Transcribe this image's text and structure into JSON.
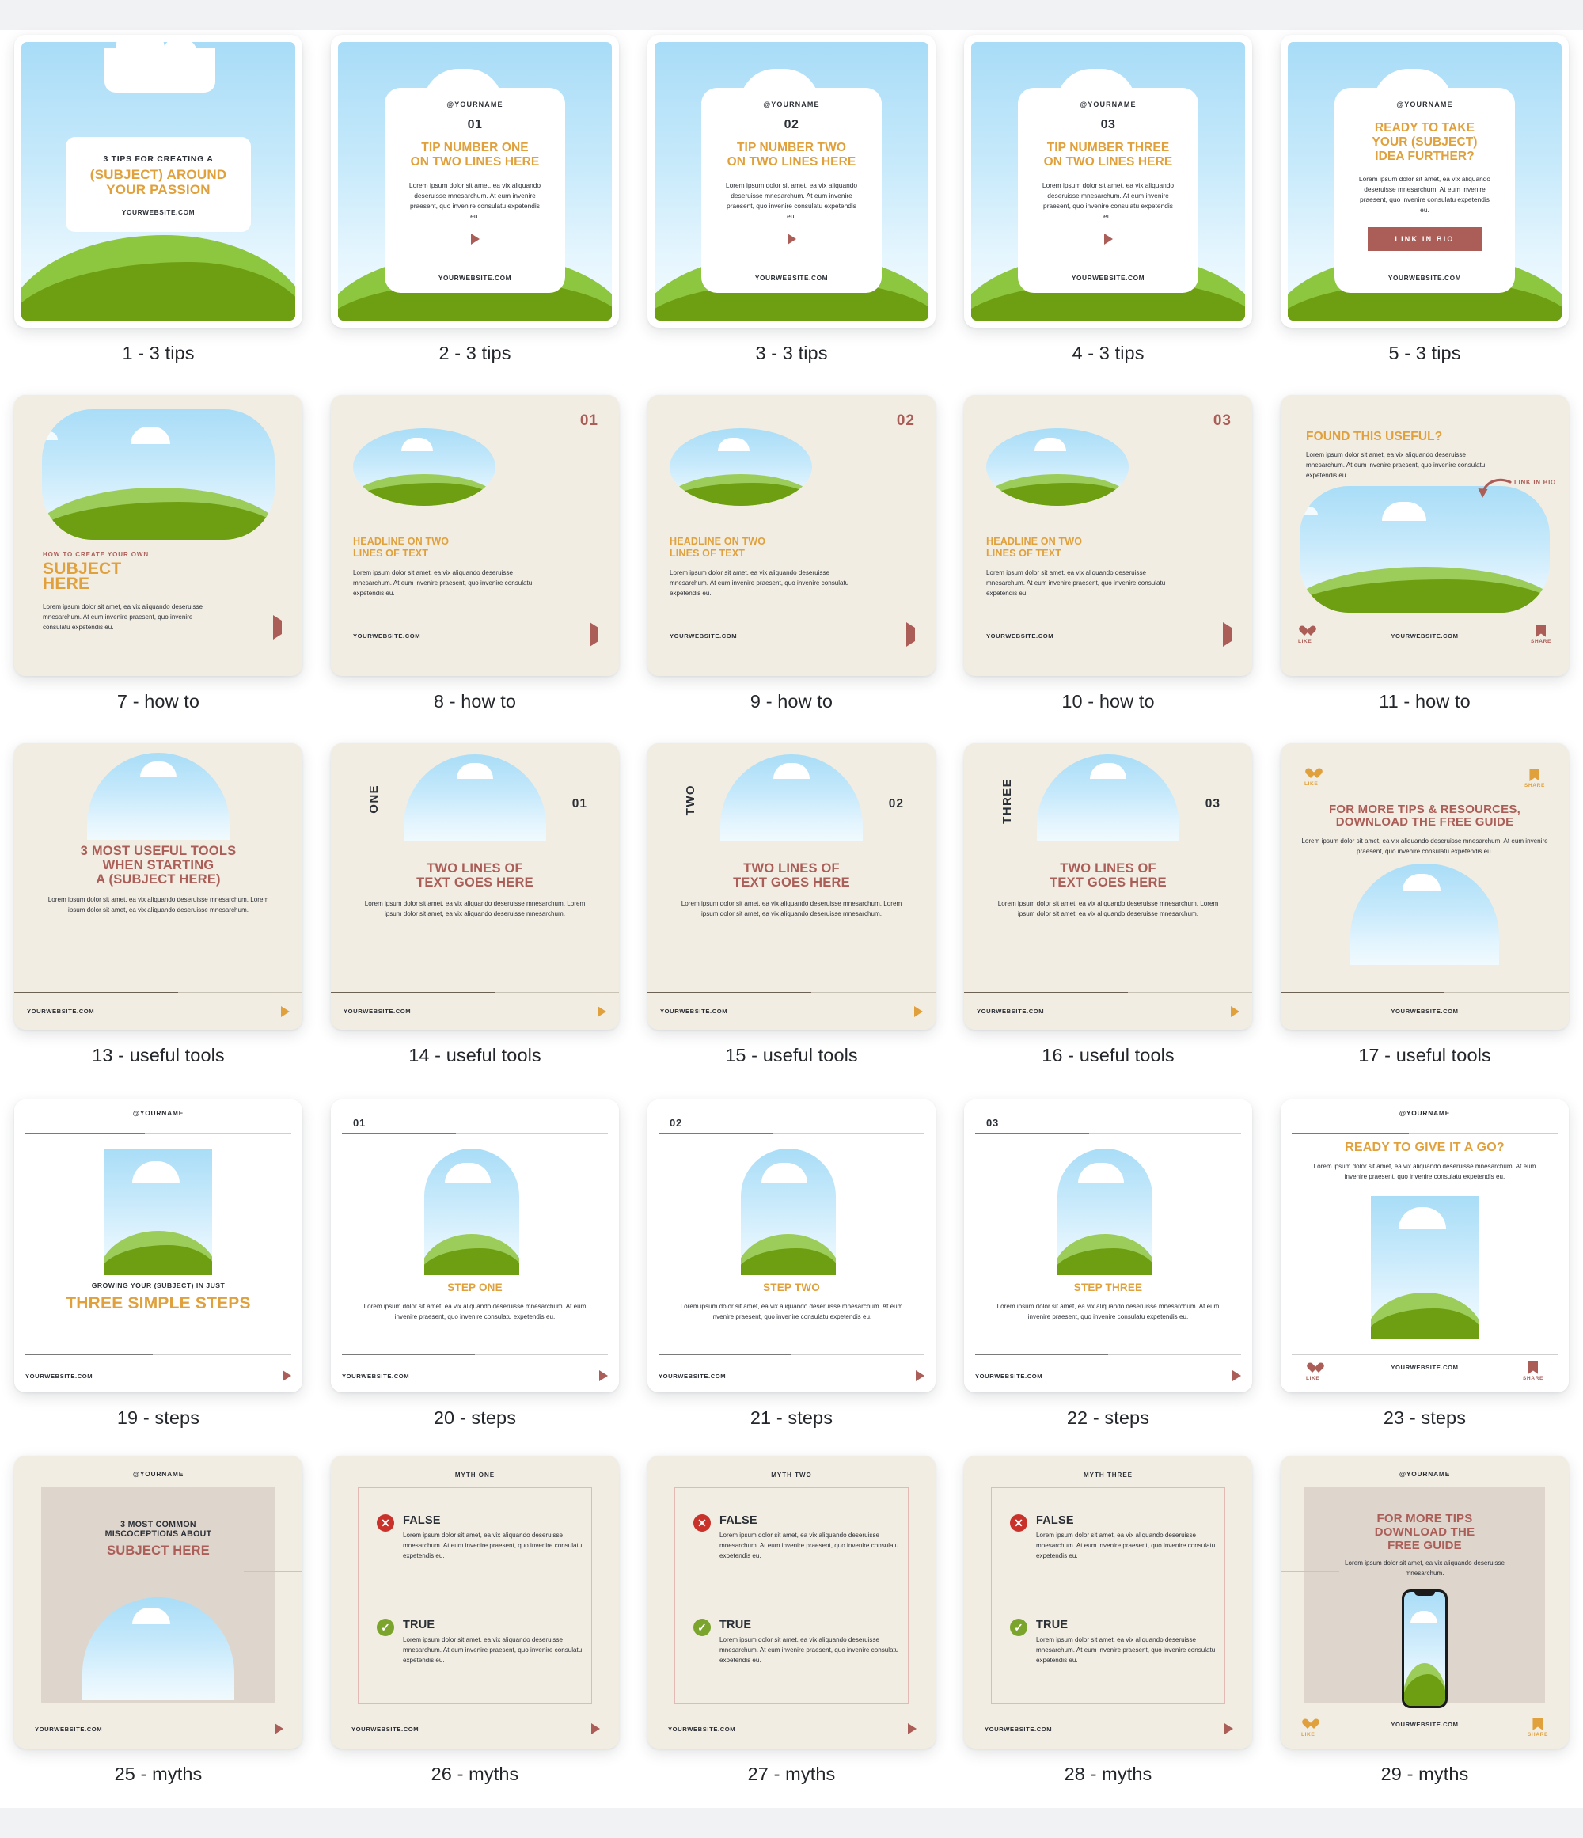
{
  "brand": {
    "orange": "#e0a13c",
    "rose": "#ab5e57",
    "green_light": "#9ccc5a",
    "green_dark": "#6e9e12",
    "sky": "#a9ddf7",
    "beige": "#f2ede3",
    "tan": "#ded5cd",
    "red": "#c8322a",
    "check_green": "#7aa42b"
  },
  "common": {
    "handle": "@YOURNAME",
    "website": "YOURWEBSITE.COM",
    "lorem_4line": "Lorem ipsum dolor sit amet, ea vix aliquando deseruisse mnesarchum. At eum invenire praesent, quo invenire consulatu expetendis eu.",
    "lorem_3line": "Lorem ipsum dolor sit amet, ea vix aliquando deseruisse mnesarchum. At eum invenire praesent, quo invenire consulatu expetendis eu.",
    "lorem_long": "Lorem ipsum dolor sit amet, ea vix aliquando deseruisse mnesarchum. Lorem ipsum dolor sit amet, ea vix aliquando deseruisse mnesarchum.",
    "lorem_short": "Lorem ipsum dolor sit amet, ea vix aliquando deseruisse mnesarchum.",
    "like": "LIKE",
    "share": "SHARE",
    "link_in_bio": "LINK IN BIO"
  },
  "cards": [
    {
      "caption": "1 - 3 tips",
      "eyebrow": "3 TIPS FOR CREATING A",
      "title": "(SUBJECT) AROUND YOUR PASSION",
      "website": "YOURWEBSITE.COM"
    },
    {
      "caption": "2 - 3 tips",
      "handle": "@YOURNAME",
      "number": "01",
      "title_l1": "TIP NUMBER ONE",
      "title_l2": "ON TWO LINES HERE",
      "body": "Lorem ipsum dolor sit amet, ea vix aliquando deseruisse mnesarchum. At eum invenire praesent, quo invenire consulatu expetendis eu.",
      "website": "YOURWEBSITE.COM"
    },
    {
      "caption": "3 - 3 tips",
      "handle": "@YOURNAME",
      "number": "02",
      "title_l1": "TIP NUMBER TWO",
      "title_l2": "ON TWO LINES HERE",
      "body": "Lorem ipsum dolor sit amet, ea vix aliquando deseruisse mnesarchum. At eum invenire praesent, quo invenire consulatu expetendis eu.",
      "website": "YOURWEBSITE.COM"
    },
    {
      "caption": "4 - 3 tips",
      "handle": "@YOURNAME",
      "number": "03",
      "title_l1": "TIP NUMBER THREE",
      "title_l2": "ON TWO LINES HERE",
      "body": "Lorem ipsum dolor sit amet, ea vix aliquando deseruisse mnesarchum. At eum invenire praesent, quo invenire consulatu expetendis eu.",
      "website": "YOURWEBSITE.COM"
    },
    {
      "caption": "5 - 3 tips",
      "handle": "@YOURNAME",
      "title_l1": "READY TO TAKE",
      "title_l2": "YOUR (SUBJECT)",
      "title_l3": "IDEA FURTHER?",
      "body": "Lorem ipsum dolor sit amet, ea vix aliquando deseruisse mnesarchum. At eum invenire praesent, quo invenire consulatu expetendis eu.",
      "button": "LINK IN BIO",
      "website": "YOURWEBSITE.COM"
    },
    {
      "caption": "7 - how to",
      "kicker": "HOW TO CREATE YOUR OWN",
      "title_l1": "SUBJECT",
      "title_l2": "HERE",
      "body": "Lorem ipsum dolor sit amet, ea vix aliquando deseruisse mnesarchum. At eum invenire praesent, quo invenire consulatu expetendis eu."
    },
    {
      "caption": "8 - how to",
      "number": "01",
      "title_l1": "HEADLINE ON TWO",
      "title_l2": "LINES OF TEXT",
      "body": "Lorem ipsum dolor sit amet, ea vix aliquando deseruisse mnesarchum. At eum invenire praesent, quo invenire consulatu expetendis eu.",
      "website": "YOURWEBSITE.COM"
    },
    {
      "caption": "9 - how to",
      "number": "02",
      "title_l1": "HEADLINE ON TWO",
      "title_l2": "LINES OF TEXT",
      "body": "Lorem ipsum dolor sit amet, ea vix aliquando deseruisse mnesarchum. At eum invenire praesent, quo invenire consulatu expetendis eu.",
      "website": "YOURWEBSITE.COM"
    },
    {
      "caption": "10 - how to",
      "number": "03",
      "title_l1": "HEADLINE ON TWO",
      "title_l2": "LINES OF TEXT",
      "body": "Lorem ipsum dolor sit amet, ea vix aliquando deseruisse mnesarchum. At eum invenire praesent, quo invenire consulatu expetendis eu.",
      "website": "YOURWEBSITE.COM"
    },
    {
      "caption": "11 - how to",
      "title": "FOUND THIS USEFUL?",
      "body": "Lorem ipsum dolor sit amet, ea vix aliquando deseruisse mnesarchum. At eum invenire praesent, quo invenire consulatu expetendis eu.",
      "annotation": "LINK IN BIO",
      "like": "LIKE",
      "share": "SHARE",
      "website": "YOURWEBSITE.COM"
    },
    {
      "caption": "13 - useful tools",
      "title_l1": "3 MOST USEFUL TOOLS",
      "title_l2": "WHEN STARTING",
      "title_l3": "A (SUBJECT HERE)",
      "body": "Lorem ipsum dolor sit amet, ea vix aliquando deseruisse mnesarchum. Lorem ipsum dolor sit amet, ea vix aliquando deseruisse mnesarchum.",
      "website": "YOURWEBSITE.COM"
    },
    {
      "caption": "14 - useful tools",
      "word": "ONE",
      "number": "01",
      "title_l1": "TWO LINES OF",
      "title_l2": "TEXT GOES HERE",
      "body": "Lorem ipsum dolor sit amet, ea vix aliquando deseruisse mnesarchum. Lorem ipsum dolor sit amet, ea vix aliquando deseruisse mnesarchum.",
      "website": "YOURWEBSITE.COM"
    },
    {
      "caption": "15 - useful tools",
      "word": "TWO",
      "number": "02",
      "title_l1": "TWO LINES OF",
      "title_l2": "TEXT GOES HERE",
      "body": "Lorem ipsum dolor sit amet, ea vix aliquando deseruisse mnesarchum. Lorem ipsum dolor sit amet, ea vix aliquando deseruisse mnesarchum.",
      "website": "YOURWEBSITE.COM"
    },
    {
      "caption": "16 - useful tools",
      "word": "THREE",
      "number": "03",
      "title_l1": "TWO LINES OF",
      "title_l2": "TEXT GOES HERE",
      "body": "Lorem ipsum dolor sit amet, ea vix aliquando deseruisse mnesarchum. Lorem ipsum dolor sit amet, ea vix aliquando deseruisse mnesarchum.",
      "website": "YOURWEBSITE.COM"
    },
    {
      "caption": "17 - useful tools",
      "title_l1": "FOR MORE TIPS & RESOURCES,",
      "title_l2": "DOWNLOAD THE FREE GUIDE",
      "body": "Lorem ipsum dolor sit amet, ea vix aliquando deseruisse mnesarchum. At eum invenire praesent, quo invenire consulatu expetendis eu.",
      "like": "LIKE",
      "share": "SHARE",
      "website": "YOURWEBSITE.COM"
    },
    {
      "caption": "19 - steps",
      "handle": "@YOURNAME",
      "kicker": "GROWING YOUR (SUBJECT) IN JUST",
      "title": "THREE SIMPLE STEPS",
      "website": "YOURWEBSITE.COM"
    },
    {
      "caption": "20 - steps",
      "number": "01",
      "title": "STEP ONE",
      "body": "Lorem ipsum dolor sit amet, ea vix aliquando deseruisse mnesarchum. At eum invenire praesent, quo invenire consulatu expetendis eu.",
      "website": "YOURWEBSITE.COM"
    },
    {
      "caption": "21 - steps",
      "number": "02",
      "title": "STEP TWO",
      "body": "Lorem ipsum dolor sit amet, ea vix aliquando deseruisse mnesarchum. At eum invenire praesent, quo invenire consulatu expetendis eu.",
      "website": "YOURWEBSITE.COM"
    },
    {
      "caption": "22 - steps",
      "number": "03",
      "title": "STEP THREE",
      "body": "Lorem ipsum dolor sit amet, ea vix aliquando deseruisse mnesarchum. At eum invenire praesent, quo invenire consulatu expetendis eu.",
      "website": "YOURWEBSITE.COM"
    },
    {
      "caption": "23 - steps",
      "handle": "@YOURNAME",
      "title": "READY TO GIVE IT A GO?",
      "body": "Lorem ipsum dolor sit amet, ea vix aliquando deseruisse mnesarchum. At eum invenire praesent, quo invenire consulatu expetendis eu.",
      "like": "LIKE",
      "share": "SHARE",
      "website": "YOURWEBSITE.COM"
    },
    {
      "caption": "25 - myths",
      "handle": "@YOURNAME",
      "eyebrow_l1": "3 MOST COMMON",
      "eyebrow_l2": "MISCOCEPTIONS ABOUT",
      "title": "SUBJECT HERE",
      "website": "YOURWEBSITE.COM"
    },
    {
      "caption": "26 - myths",
      "header": "MYTH ONE",
      "false_label": "FALSE",
      "false_body": "Lorem ipsum dolor sit amet, ea vix aliquando deseruisse mnesarchum. At eum invenire praesent, quo invenire consulatu expetendis eu.",
      "true_label": "TRUE",
      "true_body": "Lorem ipsum dolor sit amet, ea vix aliquando deseruisse mnesarchum. At eum invenire praesent, quo invenire consulatu expetendis eu.",
      "website": "YOURWEBSITE.COM"
    },
    {
      "caption": "27 - myths",
      "header": "MYTH TWO",
      "false_label": "FALSE",
      "false_body": "Lorem ipsum dolor sit amet, ea vix aliquando deseruisse mnesarchum. At eum invenire praesent, quo invenire consulatu expetendis eu.",
      "true_label": "TRUE",
      "true_body": "Lorem ipsum dolor sit amet, ea vix aliquando deseruisse mnesarchum. At eum invenire praesent, quo invenire consulatu expetendis eu.",
      "website": "YOURWEBSITE.COM"
    },
    {
      "caption": "28 - myths",
      "header": "MYTH THREE",
      "false_label": "FALSE",
      "false_body": "Lorem ipsum dolor sit amet, ea vix aliquando deseruisse mnesarchum. At eum invenire praesent, quo invenire consulatu expetendis eu.",
      "true_label": "TRUE",
      "true_body": "Lorem ipsum dolor sit amet, ea vix aliquando deseruisse mnesarchum. At eum invenire praesent, quo invenire consulatu expetendis eu.",
      "website": "YOURWEBSITE.COM"
    },
    {
      "caption": "29 - myths",
      "handle": "@YOURNAME",
      "title_l1": "FOR MORE TIPS",
      "title_l2": "DOWNLOAD THE",
      "title_l3": "FREE GUIDE",
      "body": "Lorem ipsum dolor sit amet, ea vix aliquando deseruisse mnesarchum.",
      "like": "LIKE",
      "share": "SHARE",
      "website": "YOURWEBSITE.COM"
    }
  ]
}
